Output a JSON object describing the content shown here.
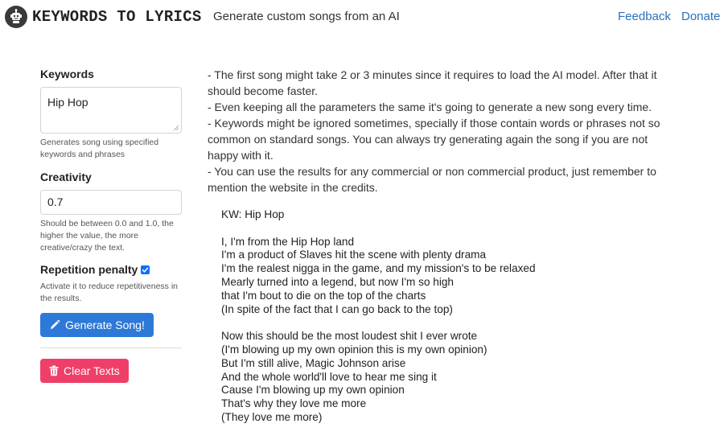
{
  "header": {
    "brand": "KEYWORDS TO LYRICS",
    "tagline": "Generate custom songs from an AI",
    "nav": {
      "feedback": "Feedback",
      "donate": "Donate"
    }
  },
  "sidebar": {
    "keywords": {
      "label": "Keywords",
      "value": "Hip Hop",
      "help": "Generates song using specified keywords and phrases"
    },
    "creativity": {
      "label": "Creativity",
      "value": "0.7",
      "help": "Should be between 0.0 and 1.0, the higher the value, the more creative/crazy the text."
    },
    "repetition": {
      "label": "Repetition penalty",
      "checked": true,
      "help": "Activate it to reduce repetitiveness in the results."
    },
    "generate_button": "Generate Song!",
    "clear_button": "Clear Texts"
  },
  "notes": [
    "- The first song might take 2 or 3 minutes since it requires to load the AI model. After that it should become faster.",
    "- Even keeping all the parameters the same it's going to generate a new song every time.",
    "- Keywords might be ignored sometimes, specially if those contain words or phrases not so common on standard songs. You can always try generating again the song if you are not happy with it.",
    "- You can use the results for any commercial or non commercial product, just remember to mention the website in the credits."
  ],
  "lyrics": {
    "kw_line": "KW: Hip Hop",
    "lines": [
      "",
      "I, I'm from the Hip Hop land",
      "I'm a product of Slaves hit the scene with plenty drama",
      "I'm the realest nigga in the game, and my mission's to be relaxed",
      "Mearly turned into a legend, but now I'm so high",
      "that I'm bout to die on the top of the charts",
      "(In spite of the fact that I can go back to the top)",
      "",
      "Now this should be the most loudest shit I ever wrote",
      "(I'm blowing up my own opinion this is my own opinion)",
      "But I'm still alive, Magic Johnson arise",
      "And the whole world'll love to hear me sing it",
      "Cause I'm blowing up my own opinion",
      "That's why they love me more",
      "(They love me more)"
    ]
  },
  "colors": {
    "link": "#2c6fbb",
    "primary_button": "#2d79d8",
    "danger_button": "#ef3f68",
    "checkbox": "#0d6efd"
  },
  "icons": {
    "logo": "robot-icon",
    "generate": "pencil-icon",
    "clear": "trash-icon"
  }
}
